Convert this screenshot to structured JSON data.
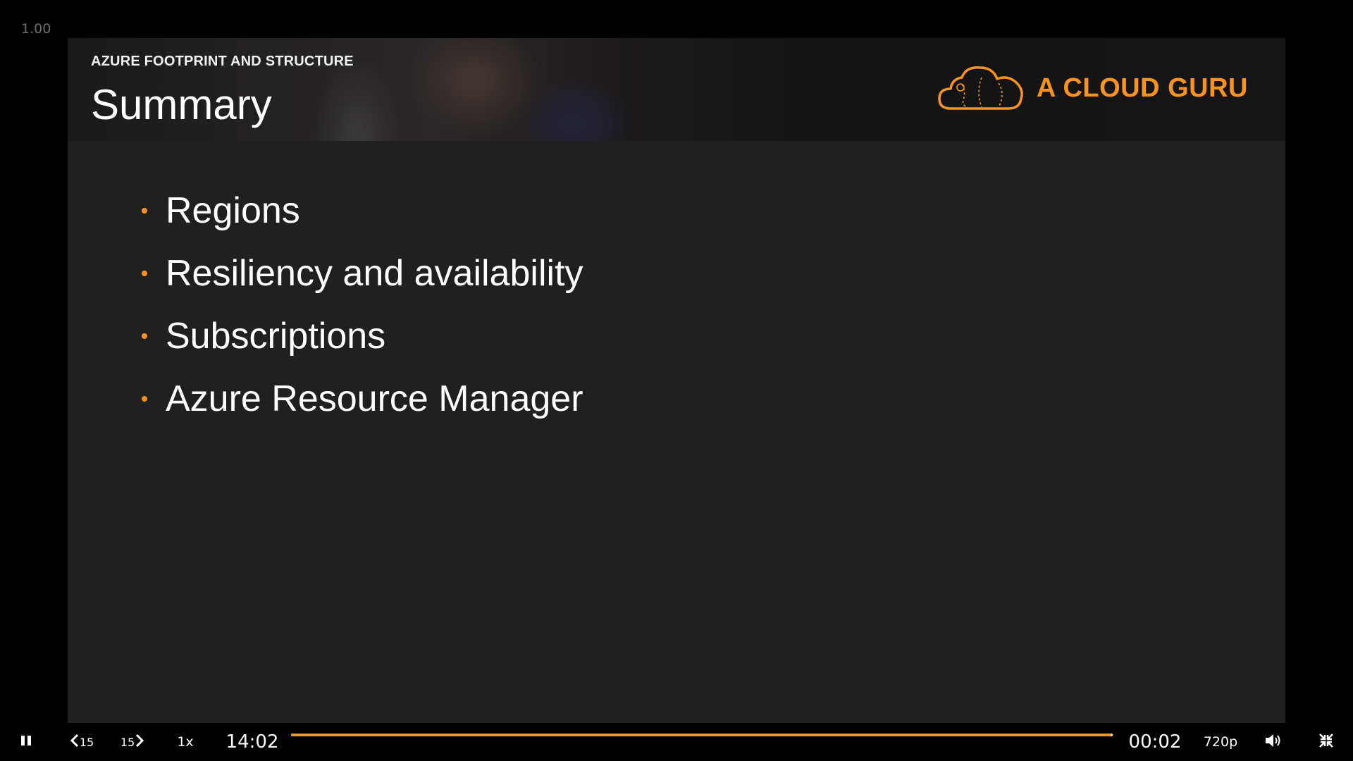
{
  "player": {
    "speed_readout": "1.00"
  },
  "slide": {
    "kicker": "AZURE FOOTPRINT AND STRUCTURE",
    "title": "Summary",
    "brand_name": "A CLOUD GURU",
    "brand_logo_icon": "cloud-logo-icon",
    "accent_color": "#f7931e",
    "bullets": [
      "Regions",
      "Resiliency and availability",
      "Subscriptions",
      "Azure Resource Manager"
    ]
  },
  "controls": {
    "pause_icon": "pause-icon",
    "rewind_label": "15",
    "forward_label": "15",
    "speed_label": "1x",
    "elapsed": "14:02",
    "remaining": "00:02",
    "progress_fraction": 0.998,
    "quality_label": "720p",
    "volume_icon": "volume-icon",
    "fullscreen_exit_icon": "exit-fullscreen-icon"
  }
}
